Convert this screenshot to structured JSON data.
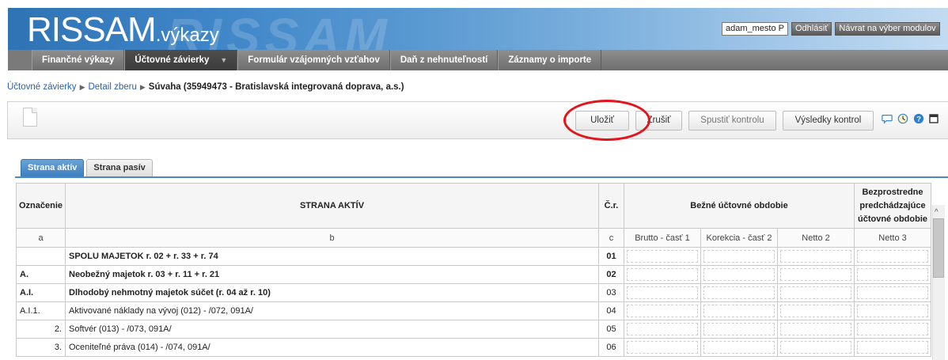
{
  "app": {
    "logo_main": "RISSAM",
    "logo_suffix": ".výkazy",
    "watermark": "RISSAM"
  },
  "user": {
    "name": "adam_mesto P",
    "logout": "Odhlásiť",
    "back_to_modules": "Návrat na výber modulov"
  },
  "nav": {
    "items": [
      {
        "label": "Finančné výkazy"
      },
      {
        "label": "Účtovné závierky",
        "caret": "▼"
      },
      {
        "label": "Formulár vzájomných vzťahov"
      },
      {
        "label": "Daň z nehnuteľností"
      },
      {
        "label": "Záznamy o importe"
      }
    ]
  },
  "breadcrumb": {
    "items": [
      "Účtovné závierky",
      "Detail zberu"
    ],
    "separator": "▶",
    "current": "Súvaha (35949473 - Bratislavská integrovaná doprava, a.s.)"
  },
  "toolbar": {
    "save": "Uložiť",
    "cancel": "Zrušiť",
    "run_check": "Spustiť kontrolu",
    "check_results": "Výsledky kontrol",
    "icons": [
      "comment-icon",
      "clock-icon",
      "help-icon",
      "window-icon"
    ],
    "colors": {
      "accent": "#2f73b4",
      "highlight": "#e3141b"
    }
  },
  "tabs": [
    "Strana aktív",
    "Strana pasív"
  ],
  "table": {
    "headers": {
      "oznacenie": "Označenie",
      "strana": "STRANA AKTÍV",
      "cr": "Č.r.",
      "bezne": "Bežné účtovné obdobie",
      "predch": "Bezprostredne predchádzajúce účtovné obdobie"
    },
    "subheaders": [
      "a",
      "b",
      "c",
      "Brutto - časť 1",
      "Korekcia - časť 2",
      "Netto 2",
      "Netto 3"
    ],
    "rows": [
      {
        "oznacenie": "",
        "label": "SPOLU MAJETOK r. 02 + r. 33 + r. 74",
        "cr": "01"
      },
      {
        "oznacenie": "A.",
        "label": "Neobežný majetok r. 03 + r. 11 + r. 21",
        "cr": "02"
      },
      {
        "oznacenie": "A.I.",
        "label": "Dlhodobý nehmotný majetok súčet (r. 04 až r. 10)",
        "cr": "03"
      },
      {
        "oznacenie": "A.I.1.",
        "label": "Aktivované náklady na vývoj (012) - /072, 091A/",
        "cr": "04"
      },
      {
        "oznacenie": "2.",
        "label": "Softvér (013) - /073, 091A/",
        "cr": "05"
      },
      {
        "oznacenie": "3.",
        "label": "Oceniteľné práva (014) - /074, 091A/",
        "cr": "06"
      }
    ]
  }
}
